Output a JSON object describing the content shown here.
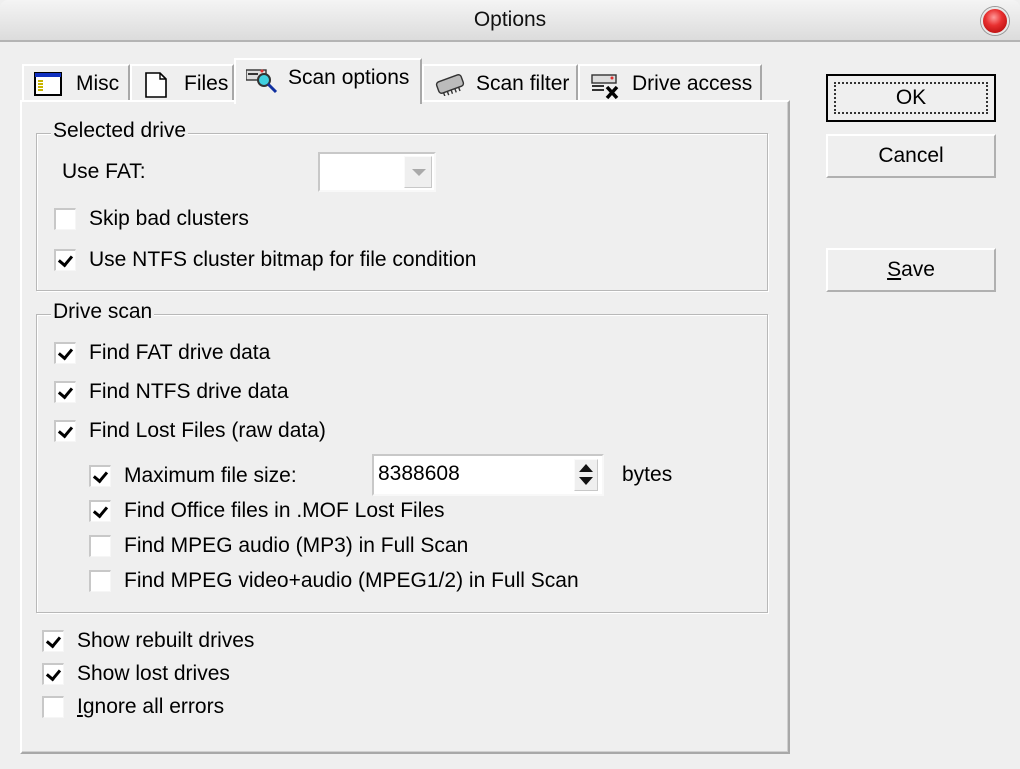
{
  "window": {
    "title": "Options"
  },
  "tabs": [
    {
      "label": "Misc",
      "icon": "misc-window-icon",
      "active": false
    },
    {
      "label": "Files",
      "icon": "file-icon",
      "active": false
    },
    {
      "label": "Scan options",
      "icon": "scan-magnifier-icon",
      "active": true
    },
    {
      "label": "Scan filter",
      "icon": "chip-icon",
      "active": false
    },
    {
      "label": "Drive access",
      "icon": "drive-access-icon",
      "active": false
    }
  ],
  "selected_drive": {
    "title": "Selected drive",
    "use_fat_label": "Use FAT:",
    "use_fat_value": "",
    "skip_bad_clusters": {
      "label": "Skip bad clusters",
      "checked": false
    },
    "use_ntfs_bitmap": {
      "label": "Use NTFS cluster bitmap for file condition",
      "checked": true
    }
  },
  "drive_scan": {
    "title": "Drive scan",
    "find_fat": {
      "label": "Find FAT drive data",
      "checked": true
    },
    "find_ntfs": {
      "label": "Find NTFS drive data",
      "checked": true
    },
    "find_lost": {
      "label": "Find Lost Files (raw data)",
      "checked": true
    },
    "max_file_size": {
      "label": "Maximum file size:",
      "checked": true,
      "value": "8388608",
      "unit": "bytes"
    },
    "find_office": {
      "label": "Find Office files in .MOF Lost Files",
      "checked": true
    },
    "find_mp3": {
      "label": "Find MPEG audio (MP3) in Full Scan",
      "checked": false
    },
    "find_mpeg": {
      "label": "Find MPEG video+audio (MPEG1/2) in Full Scan",
      "checked": false
    }
  },
  "bottom": {
    "show_rebuilt": {
      "label": "Show rebuilt drives",
      "checked": true
    },
    "show_lost": {
      "label": "Show lost drives",
      "checked": true
    },
    "ignore_errors": {
      "label_accel": "I",
      "label_rest": "gnore all errors",
      "checked": false
    }
  },
  "buttons": {
    "ok": "OK",
    "cancel": "Cancel",
    "save_accel": "S",
    "save_rest": "ave"
  }
}
